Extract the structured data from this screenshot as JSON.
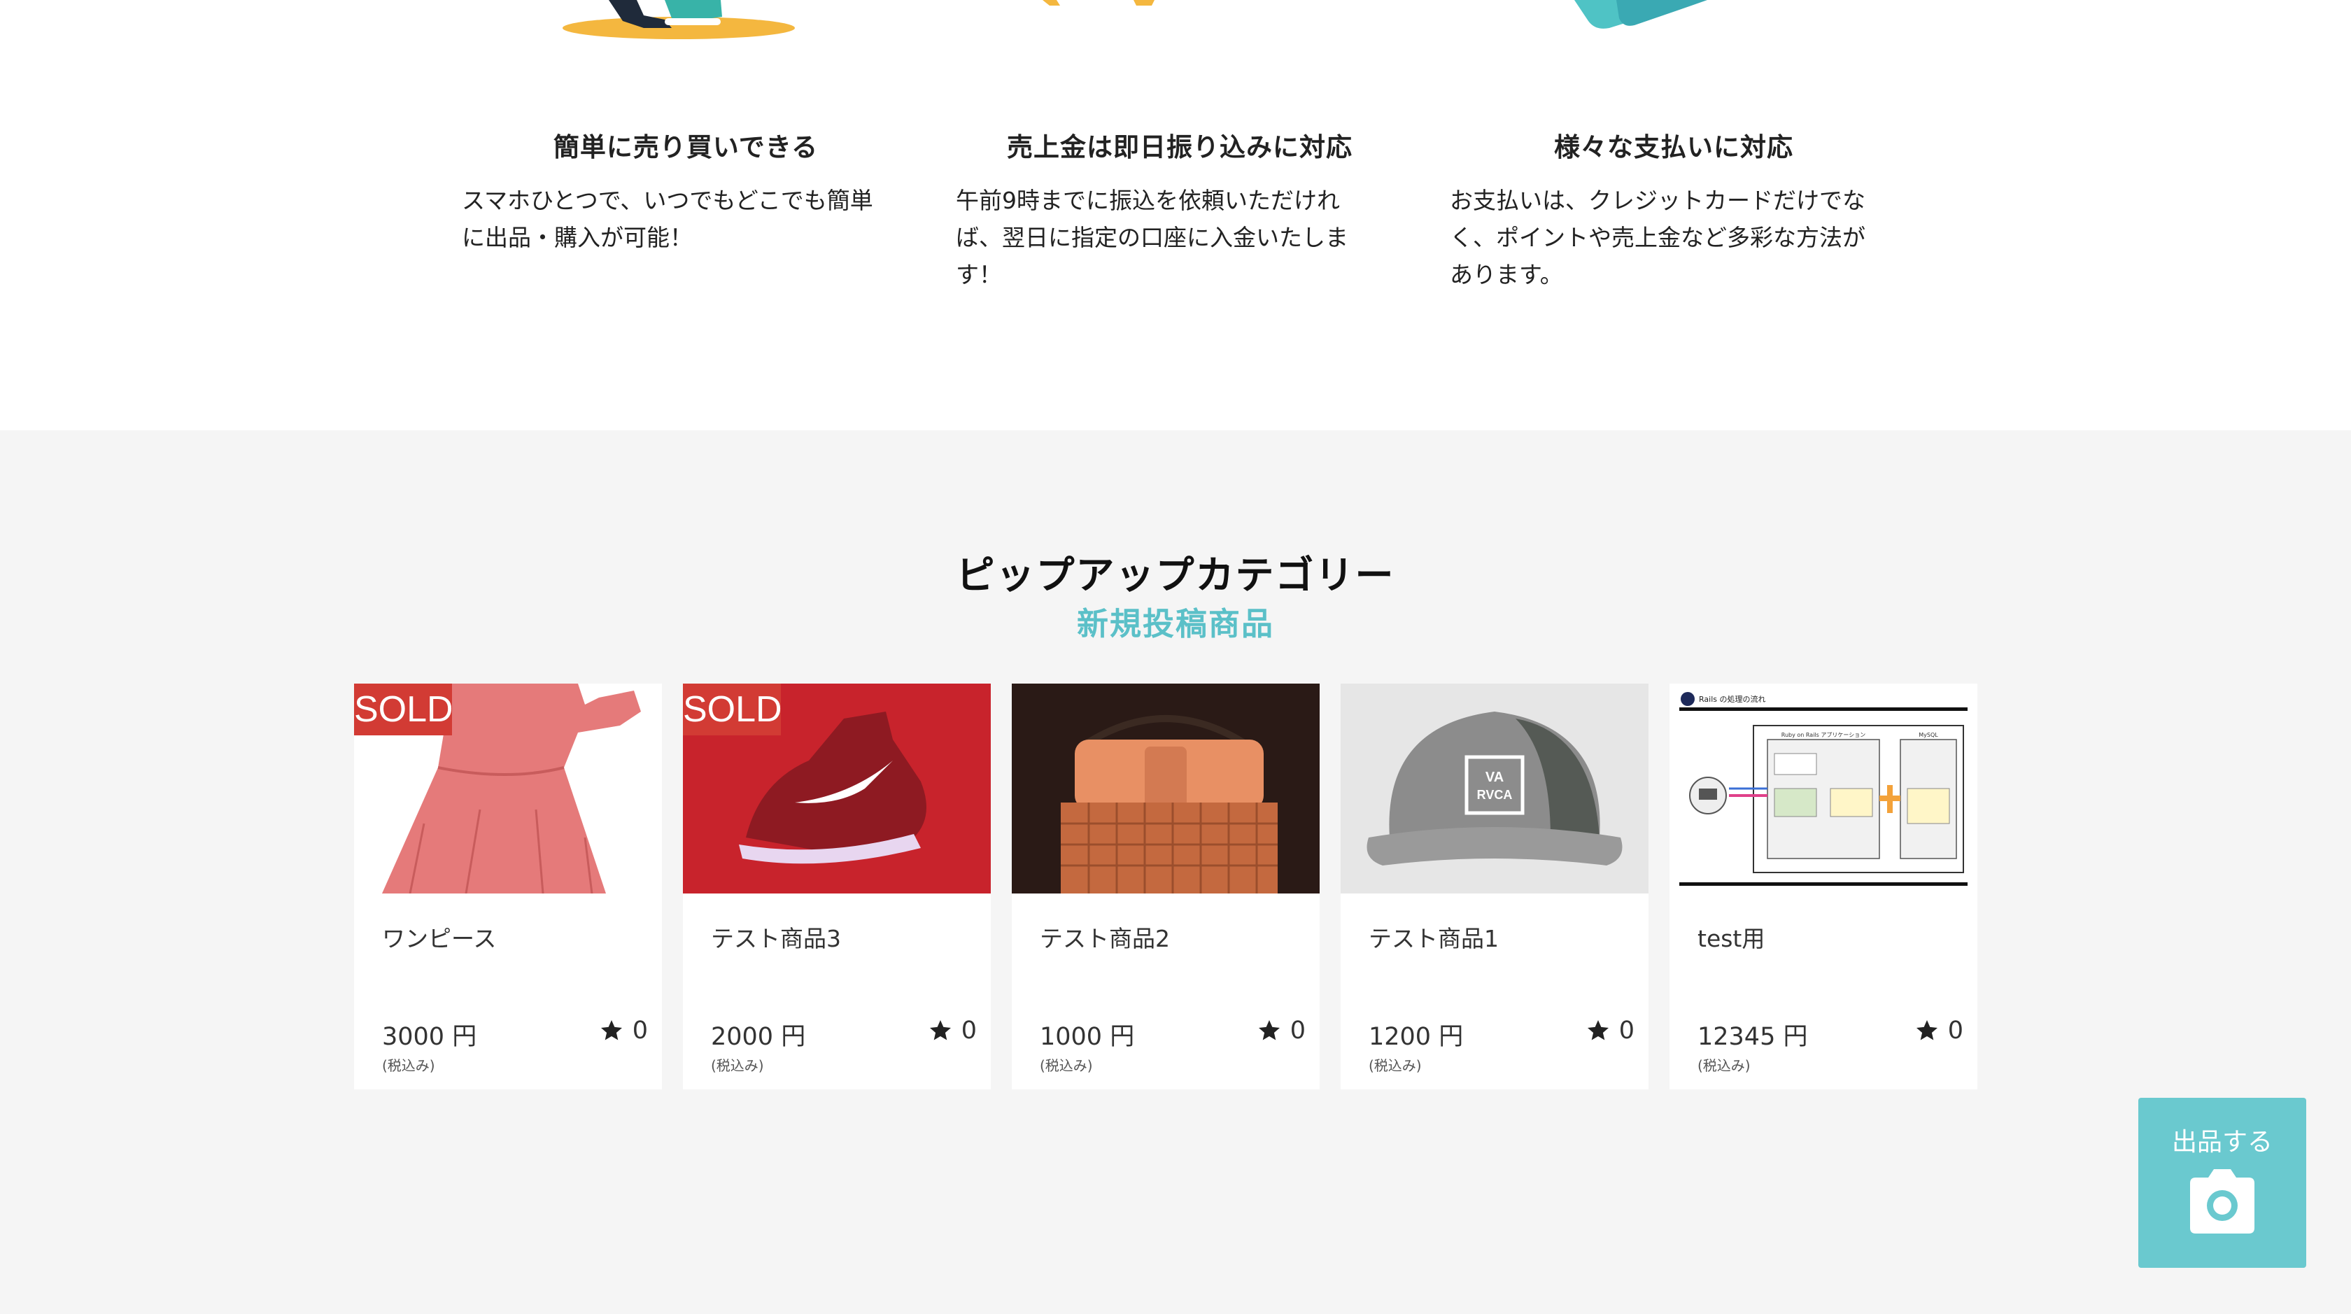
{
  "features": [
    {
      "title": "簡単に売り買いできる",
      "text_lines": [
        "スマホひとつで、いつでもどこでも簡単",
        "に出品・購入が可能！"
      ],
      "illus_icon": "sneaker-illustration-icon"
    },
    {
      "title": "売上金は即日振り込みに対応",
      "text_lines": [
        "午前9時までに振込を依頼いただけれ",
        "ば、翌日に指定の口座に入金いたしま",
        "す！"
      ],
      "illus_icon": "coins-illustration-icon"
    },
    {
      "title": "様々な支払いに対応",
      "text_lines": [
        "お支払いは、クレジットカードだけでな",
        "く、ポイントや売上金など多彩な方法が",
        "あります。"
      ],
      "illus_icon": "credit-card-illustration-icon"
    }
  ],
  "section": {
    "title": "ピップアップカテゴリー",
    "subtitle": "新規投稿商品"
  },
  "sold_label": "SOLD",
  "tax_label": "(税込み)",
  "items": [
    {
      "name": "ワンピース",
      "price": "3000 円",
      "likes": "0",
      "sold": true,
      "image": "dress-image"
    },
    {
      "name": "テスト商品3",
      "price": "2000 円",
      "likes": "0",
      "sold": true,
      "image": "sneaker-image"
    },
    {
      "name": "テスト商品2",
      "price": "1000 円",
      "likes": "0",
      "sold": false,
      "image": "handbag-image"
    },
    {
      "name": "テスト商品1",
      "price": "1200 円",
      "likes": "0",
      "sold": false,
      "image": "cap-image"
    },
    {
      "name": "test用",
      "price": "12345 円",
      "likes": "0",
      "sold": false,
      "image": "diagram-image"
    }
  ],
  "item_image_labels": {
    "diagram_header": "Rails の処理の流れ",
    "diagram_app": "Ruby on Rails アプリケーション",
    "diagram_db": "MySQL",
    "cap_logo_top": "VA",
    "cap_logo_bottom": "RVCA"
  },
  "sell_button": {
    "label": "出品する",
    "icon": "camera-icon"
  },
  "colors": {
    "accent": "#5bc0c8",
    "sell_button": "#6ac9cf",
    "sold_badge": "#d23b34",
    "section_bg": "#f5f5f5"
  }
}
